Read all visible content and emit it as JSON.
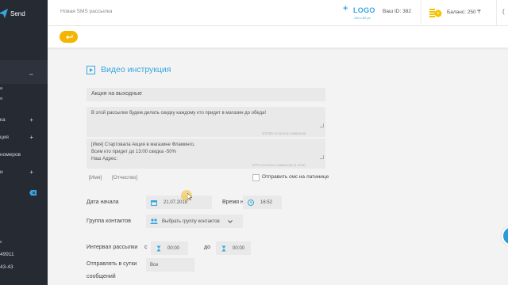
{
  "sidebar": {
    "brand": "Send",
    "items": [
      {
        "label": "",
        "marker": "−"
      },
      {
        "label": "а",
        "marker": ""
      },
      {
        "label": "я",
        "marker": ""
      },
      {
        "label": "ка",
        "marker": "+"
      },
      {
        "label": "ция",
        "marker": "+"
      },
      {
        "label": "номеров",
        "marker": ""
      },
      {
        "label": "и",
        "marker": "+"
      }
    ],
    "footer": {
      "c": "с",
      "phone1": "49911",
      "phone2": "43-43"
    }
  },
  "topbar": {
    "breadcrumb": "Новая SMS рассылка",
    "logo_plus": "+",
    "logo": "LOGO",
    "logo_size": "150 x 80 px",
    "user_id": "Ваш ID: 382",
    "balance": "Баланс: 250 ₸",
    "edge_mark": "(",
    "coin_symbol": "₸"
  },
  "section_title": "Видео инструкция",
  "form": {
    "campaign_name": "Акция на выходные",
    "message1": "В этой рассылке будем делать скидку каждому кто придет в магазин до обеда!",
    "counter1": "0/1000 осталось символов",
    "message2_lines": [
      "[Имя] Стартовала Акция в магазине Фламинго.",
      "Всем кто придет до 13:00 скидка -50%",
      "Наш Адрес:"
    ],
    "counter2": "0/70 осталось символов (1 sms)",
    "tag_name": "[Имя]",
    "tag_patronymic": "[Отчество]",
    "latin_label": "Отправить смс на латинице",
    "start_date_label": "Дата начала",
    "start_date": "21.07.2018",
    "start_time_label": "Время начала",
    "start_time": "16:52",
    "group_label": "Группа контактов",
    "group_select": "Выбрать группу контактов",
    "interval_label": "Интервал рассылки",
    "from_word": "с",
    "from_time": "00:00",
    "to_word": "до",
    "to_time": "00:00",
    "per_day_label_1": "Отправлять в сутки",
    "per_day_label_2": "сообщений",
    "per_day_value": "Все"
  },
  "colors": {
    "accent": "#37a6df",
    "back_button": "#f4b400",
    "sidebar": "#262a33"
  }
}
